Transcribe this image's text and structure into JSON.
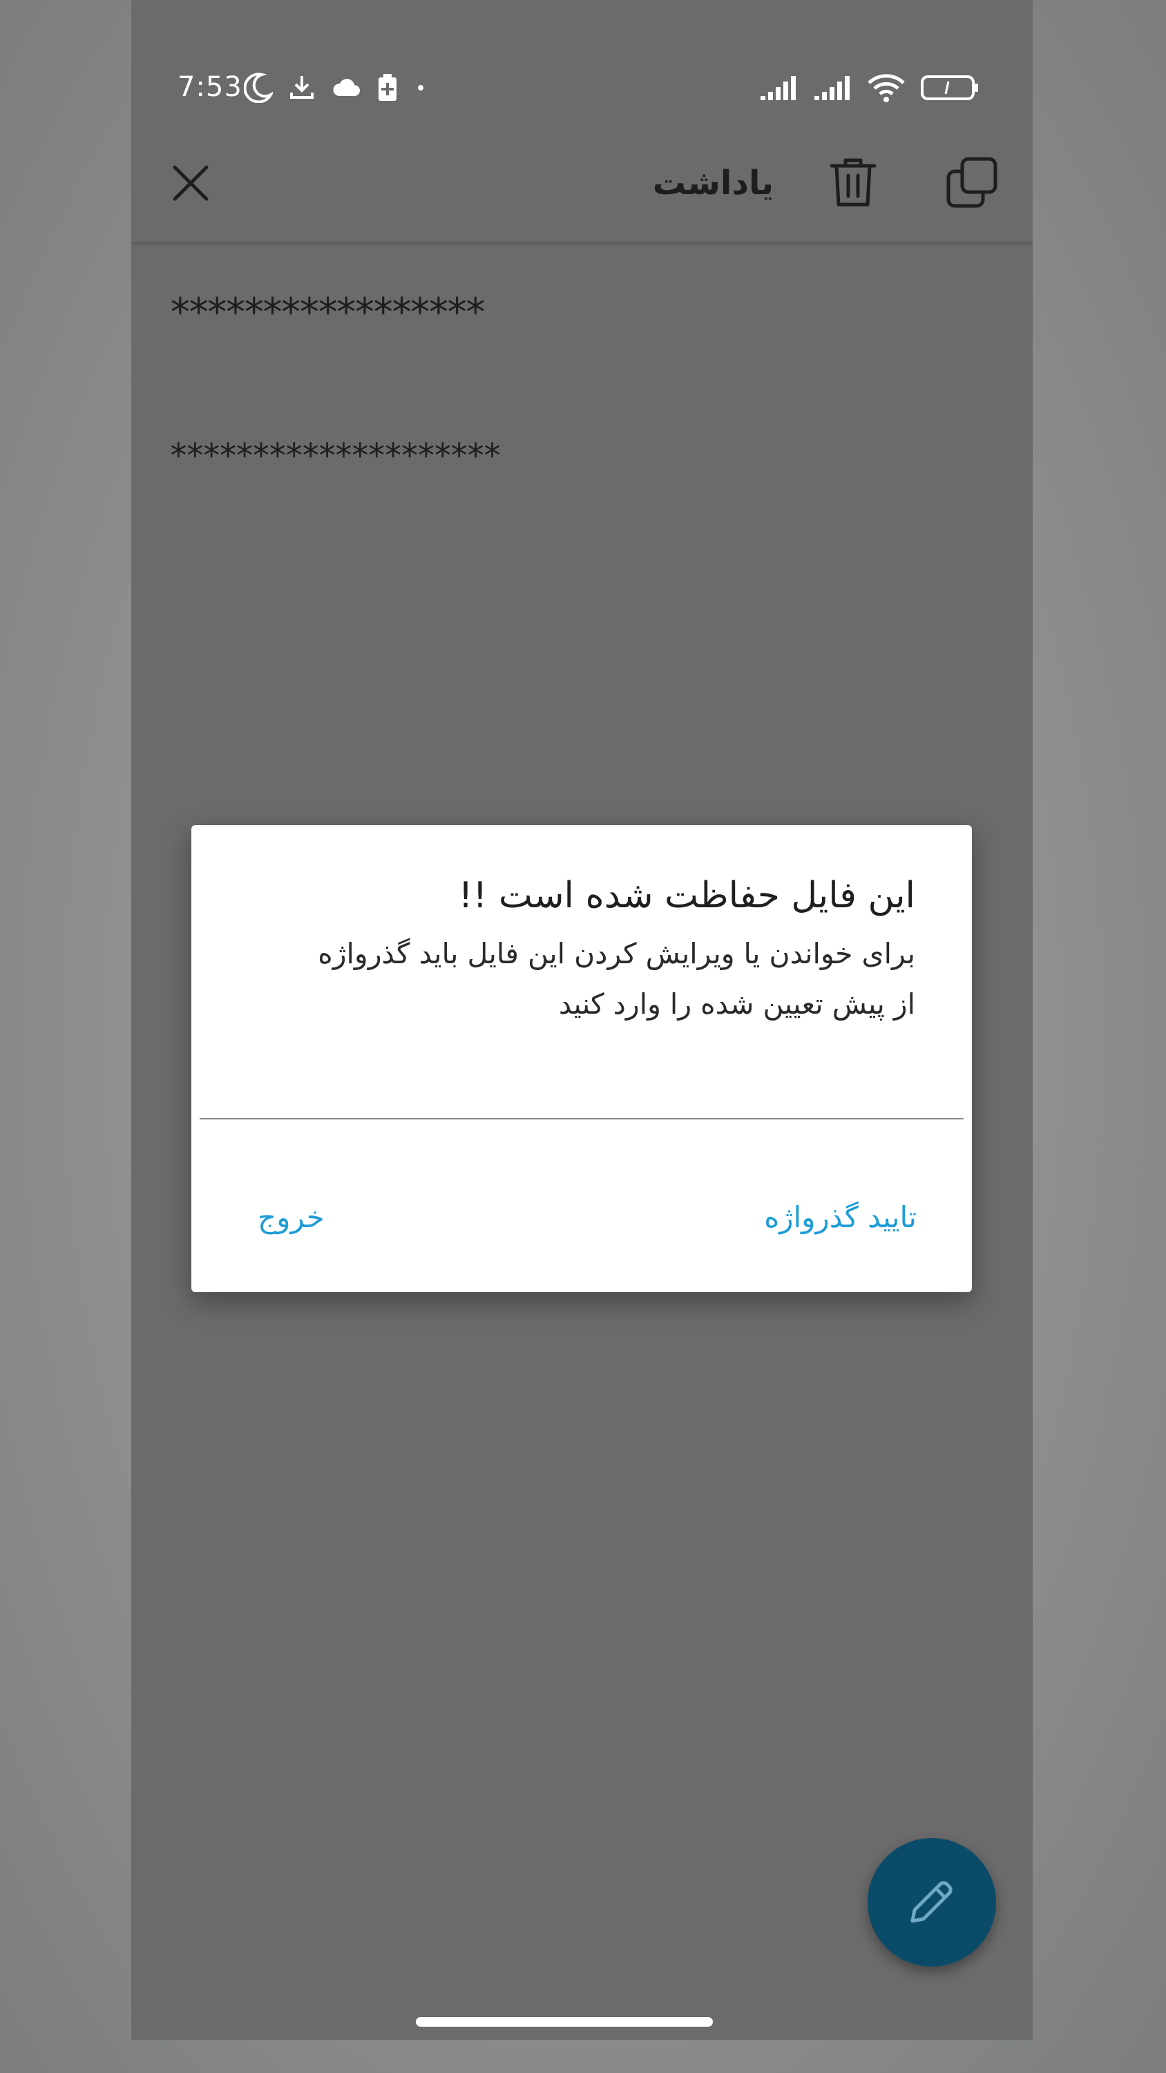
{
  "status_bar": {
    "time": "7:53",
    "left_icons": [
      "moon-icon",
      "download-icon",
      "cloud-icon",
      "battery-saver-icon",
      "dot-icon"
    ],
    "right_icons": [
      "signal-icon",
      "signal-icon",
      "wifi-icon",
      "battery-icon"
    ]
  },
  "app_bar": {
    "title": "یاداشت",
    "icons": [
      "close-icon",
      "trash-icon",
      "copy-icon"
    ]
  },
  "note": {
    "line1": "*****************",
    "line2": "********************"
  },
  "dialog": {
    "title": "این فایل حفاظت شده است !!",
    "message": "برای خواندن یا ویرایش کردن این فایل باید گذرواژه از پیش تعیین شده را وارد کنید",
    "input_value": "",
    "confirm_label": "تایید گذرواژه",
    "exit_label": "خروج"
  },
  "fab": {
    "icon": "pencil-icon"
  },
  "colors": {
    "overlay_background": "#6b6b6b",
    "dialog_background": "#ffffff",
    "accent": "#1d9dd6",
    "fab": "#0b4b6a",
    "text_dark": "#1e1e1e"
  }
}
